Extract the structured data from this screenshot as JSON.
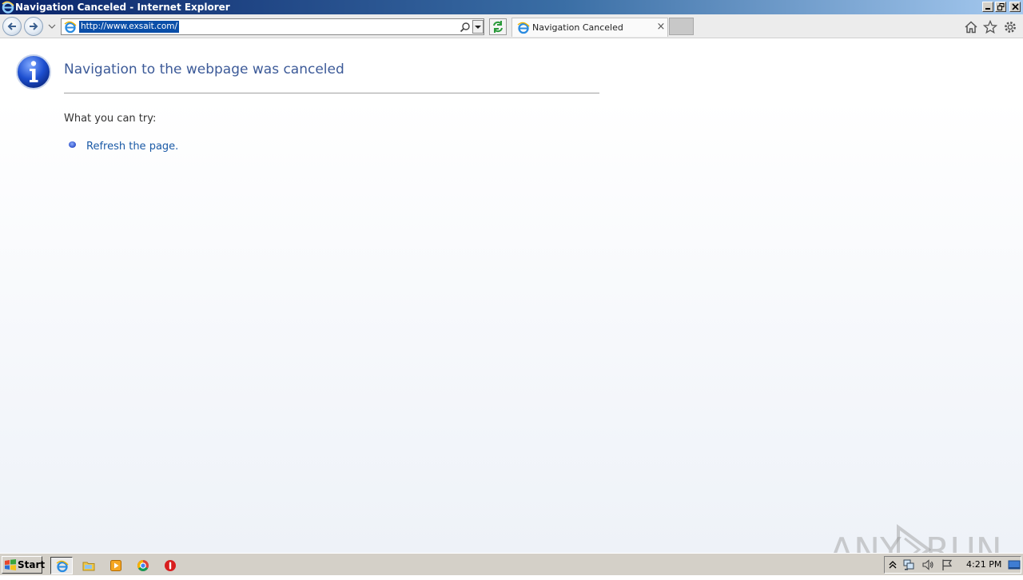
{
  "window": {
    "title": "Navigation Canceled - Internet Explorer"
  },
  "navbar": {
    "address": "http://www.exsait.com/",
    "tab_label": "Navigation Canceled",
    "tab_close": "×"
  },
  "page": {
    "heading": "Navigation to the webpage was canceled",
    "try_label": "What you can try:",
    "refresh_link": "Refresh the page."
  },
  "watermark": {
    "left": "ANY",
    "right": "RUN"
  },
  "taskbar": {
    "start_label": "Start",
    "clock": "4:21 PM"
  },
  "colors": {
    "heading": "#3c5a98",
    "link": "#1a5aa6",
    "titlebar_start": "#0a246a",
    "taskbar": "#d4d0c8"
  },
  "icons": [
    "ie-icon",
    "back-icon",
    "forward-icon",
    "search-icon",
    "refresh-icon",
    "home-icon",
    "favorites-star-icon",
    "settings-gear-icon",
    "info-icon",
    "folder-icon",
    "media-player-icon",
    "chrome-icon",
    "stop-icon",
    "windows-flag-icon",
    "network-icon",
    "volume-icon",
    "action-flag-icon",
    "show-desktop-icon"
  ]
}
